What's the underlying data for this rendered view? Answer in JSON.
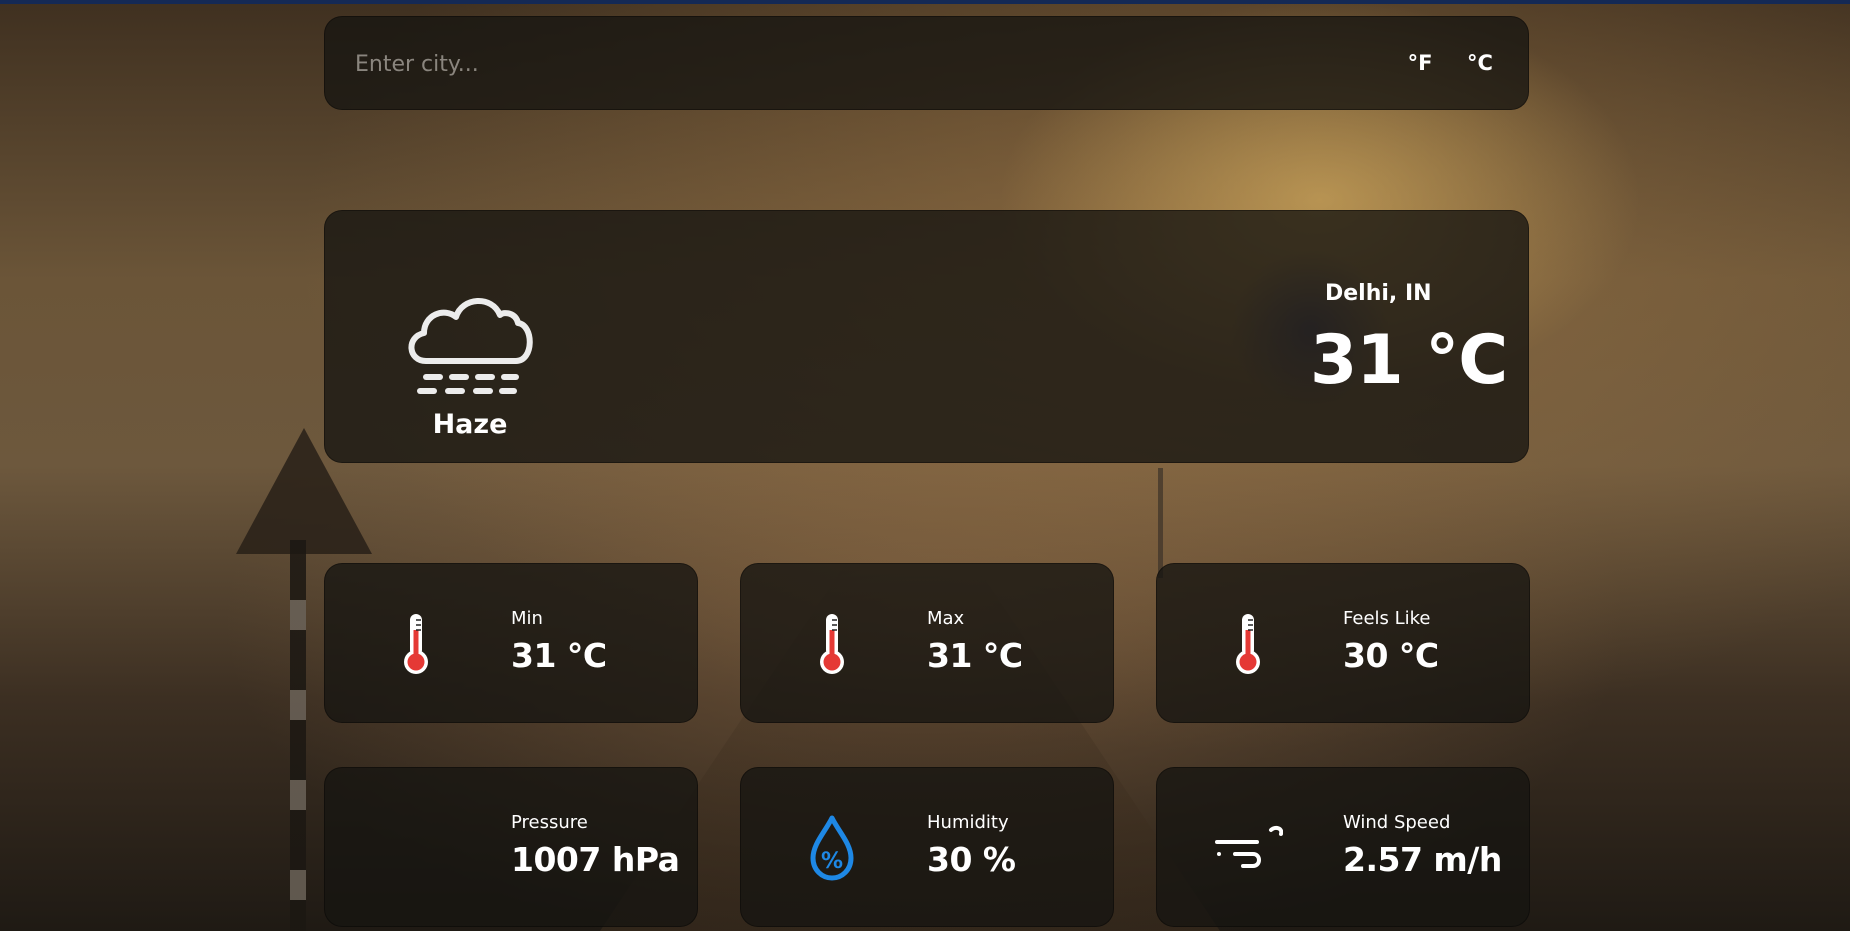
{
  "search": {
    "placeholder": "Enter city...",
    "value": ""
  },
  "units": {
    "fahrenheit_label": "°F",
    "celsius_label": "°C"
  },
  "current": {
    "condition": "Haze",
    "condition_icon": "haze-cloud-icon",
    "location": "Delhi, IN",
    "temperature": "31 °C"
  },
  "stats": [
    {
      "label": "Min",
      "value": "31 °C",
      "icon": "thermometer-icon"
    },
    {
      "label": "Max",
      "value": "31 °C",
      "icon": "thermometer-icon"
    },
    {
      "label": "Feels Like",
      "value": "30 °C",
      "icon": "thermometer-icon"
    },
    {
      "label": "Pressure",
      "value": "1007 hPa",
      "icon": ""
    },
    {
      "label": "Humidity",
      "value": "30 %",
      "icon": "humidity-drop-icon"
    },
    {
      "label": "Wind Speed",
      "value": "2.57 m/h",
      "icon": "wind-icon"
    }
  ],
  "colors": {
    "accent_red": "#e53935",
    "accent_blue": "#1e88e5",
    "card_bg": "#16140f"
  }
}
